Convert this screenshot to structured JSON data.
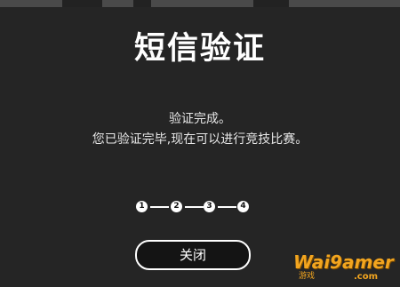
{
  "dialog": {
    "title": "短信验证",
    "message_line1": "验证完成。",
    "message_line2": "您已验证完毕,现在可以进行竞技比赛。",
    "steps": [
      "1",
      "2",
      "3",
      "4"
    ],
    "current_step": 4,
    "close_label": "关闭"
  },
  "watermark": {
    "text": "Wai9amer",
    "sub": "游戏",
    "com": ".com"
  },
  "colors": {
    "background": "#252525",
    "text": "#ffffff",
    "watermark": "#f2a51f"
  }
}
